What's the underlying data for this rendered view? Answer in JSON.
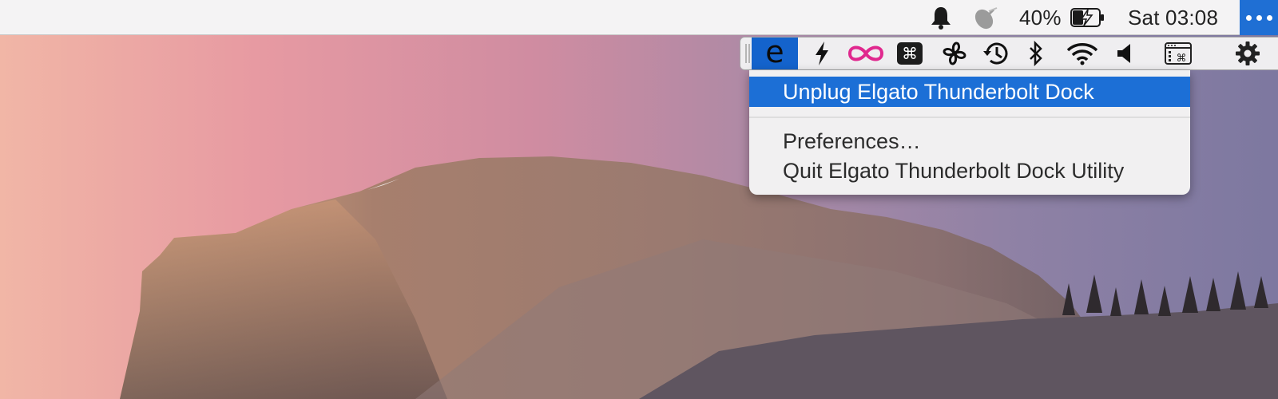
{
  "menubar": {
    "battery_percent": "40%",
    "clock": "Sat 03:08",
    "icons": [
      "notification-bell-icon",
      "satellite-dish-icon",
      "battery-charging-icon",
      "overflow-dots-icon"
    ]
  },
  "iconbar": {
    "icons": [
      {
        "name": "elgato-app-icon",
        "glyph": "e",
        "active": true
      },
      {
        "name": "lightning-icon"
      },
      {
        "name": "infinity-icon"
      },
      {
        "name": "command-key-icon",
        "glyph": "⌘"
      },
      {
        "name": "fan-icon"
      },
      {
        "name": "time-machine-icon"
      },
      {
        "name": "bluetooth-icon"
      },
      {
        "name": "wifi-icon"
      },
      {
        "name": "volume-icon"
      },
      {
        "name": "keyboard-command-window-icon"
      },
      {
        "name": "settings-gear-icon"
      }
    ]
  },
  "menu": {
    "items": [
      {
        "label": "Unplug Elgato Thunderbolt Dock",
        "highlighted": true
      },
      {
        "label": "Preferences…"
      },
      {
        "label": "Quit Elgato Thunderbolt Dock Utility"
      }
    ]
  },
  "colors": {
    "menubar_bg": "#f4f3f4",
    "selection_blue": "#1c6fd6",
    "active_icon_bg": "#1463cc",
    "infinity_magenta": "#e0288e"
  }
}
